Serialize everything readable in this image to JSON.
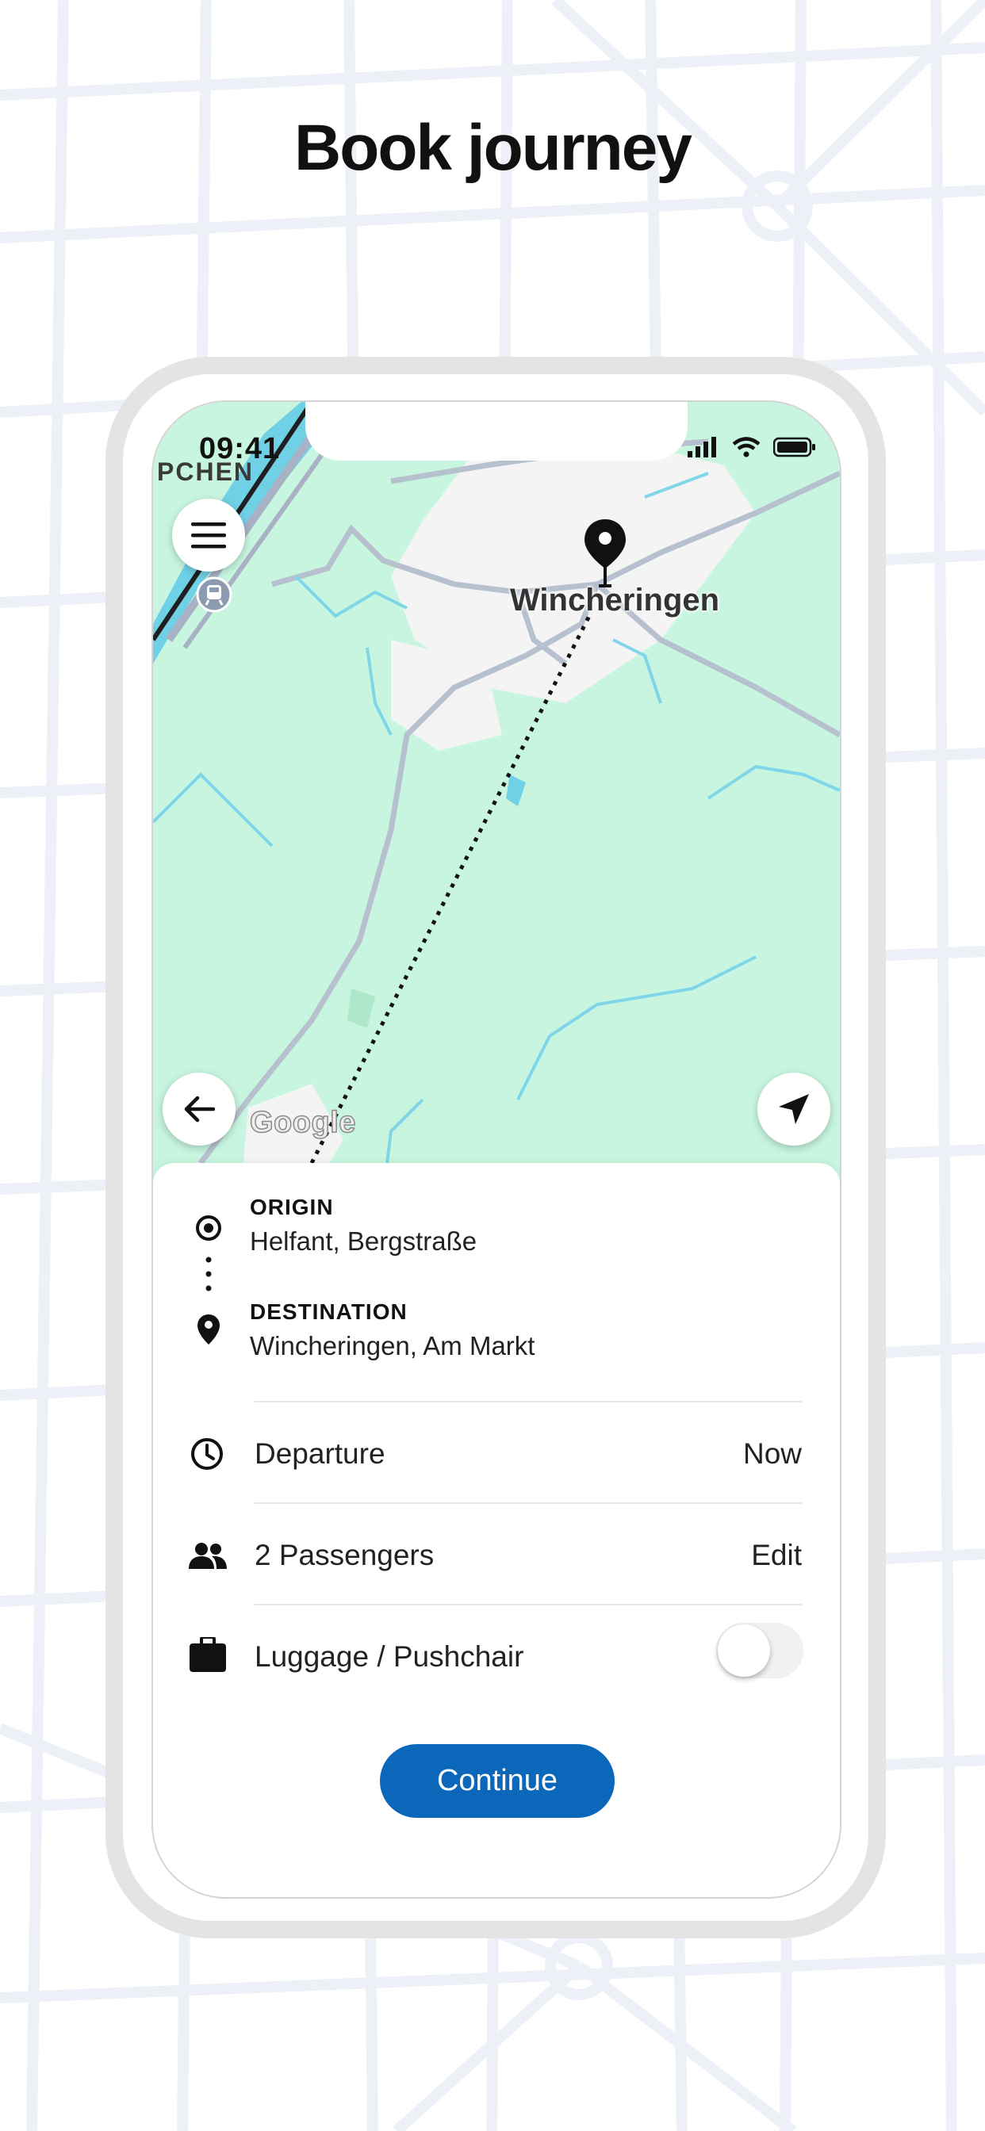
{
  "headline": "Book journey",
  "status_bar": {
    "time": "09:41"
  },
  "map": {
    "top_label": "PCHEN",
    "city_label": "Wincheringen",
    "attribution": "Google"
  },
  "trip": {
    "origin": {
      "label": "ORIGIN",
      "value": "Helfant, Bergstraße"
    },
    "destination": {
      "label": "DESTINATION",
      "value": "Wincheringen, Am Markt"
    }
  },
  "options": {
    "departure": {
      "label": "Departure",
      "value": "Now"
    },
    "passengers": {
      "label": "2 Passengers",
      "action": "Edit"
    },
    "luggage": {
      "label": "Luggage / Pushchair",
      "enabled": false
    }
  },
  "continue_label": "Continue",
  "colors": {
    "primary": "#0a67b9",
    "map_green": "#c7f5df",
    "water": "#7fd6e8"
  },
  "icons": [
    "menu-icon",
    "train-station-icon",
    "map-pin-icon",
    "back-arrow-icon",
    "navigation-arrow-icon",
    "origin-target-icon",
    "destination-pin-icon",
    "clock-icon",
    "people-icon",
    "briefcase-icon",
    "signal-icon",
    "wifi-icon",
    "battery-icon"
  ]
}
